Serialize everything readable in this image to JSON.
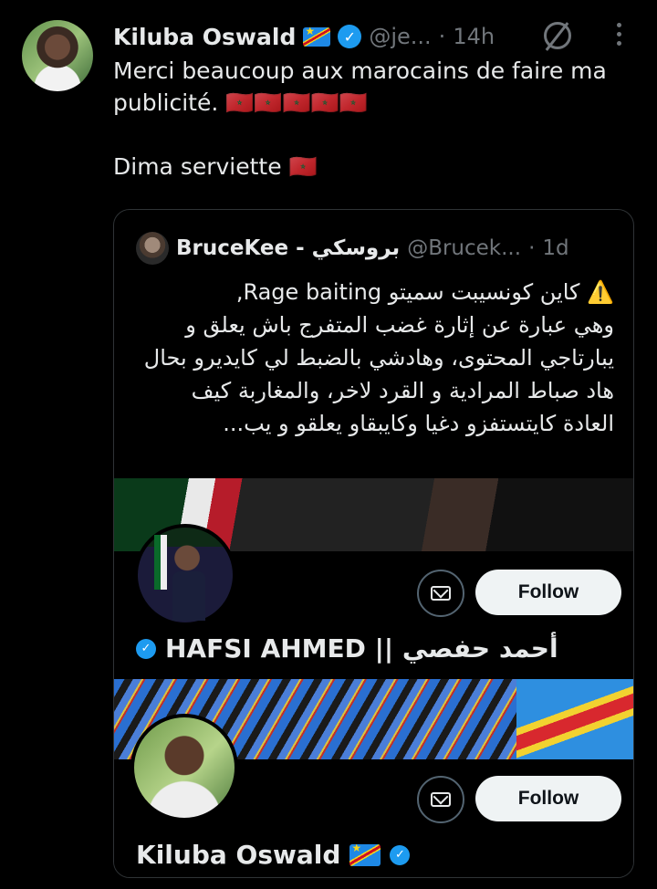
{
  "tweet": {
    "author": "Kiluba Oswald",
    "handle": "@je...",
    "separator": "·",
    "time": "14h",
    "text_line1": "Merci beaucoup aux marocains de faire ma publicité. 🇲🇦🇲🇦🇲🇦🇲🇦🇲🇦",
    "text_line2": "Dima serviette 🇲🇦",
    "flag_icon": "congo-flag-icon",
    "morocco_flag_count": 5
  },
  "quote": {
    "author": "BruceKee - بروسكي",
    "handle": "@Brucek...",
    "separator": "·",
    "time": "1d",
    "text": "⚠️ كاين كونسيبت سميتو Rage baiting,\nوهي عبارة عن إثارة غضب المتفرج باش يعلق و يبارتاجي المحتوى، وهادشي بالضبط لي كايديرو بحال هاد صباط المرادية و القرد لاخر، والمغاربة كيف العادة كايتستفزو دغيا وكايبقاو يعلقو و يب..."
  },
  "cards": [
    {
      "name": "HAFSI AHMED || أحمد حفصي",
      "follow_label": "Follow",
      "verified": true
    },
    {
      "name": "Kiluba Oswald",
      "follow_label": "Follow",
      "verified": true
    }
  ],
  "colors": {
    "background": "#000000",
    "text": "#e7e9ea",
    "muted": "#71767b",
    "verified": "#1d9bf0",
    "follow_bg": "#eff3f4"
  }
}
